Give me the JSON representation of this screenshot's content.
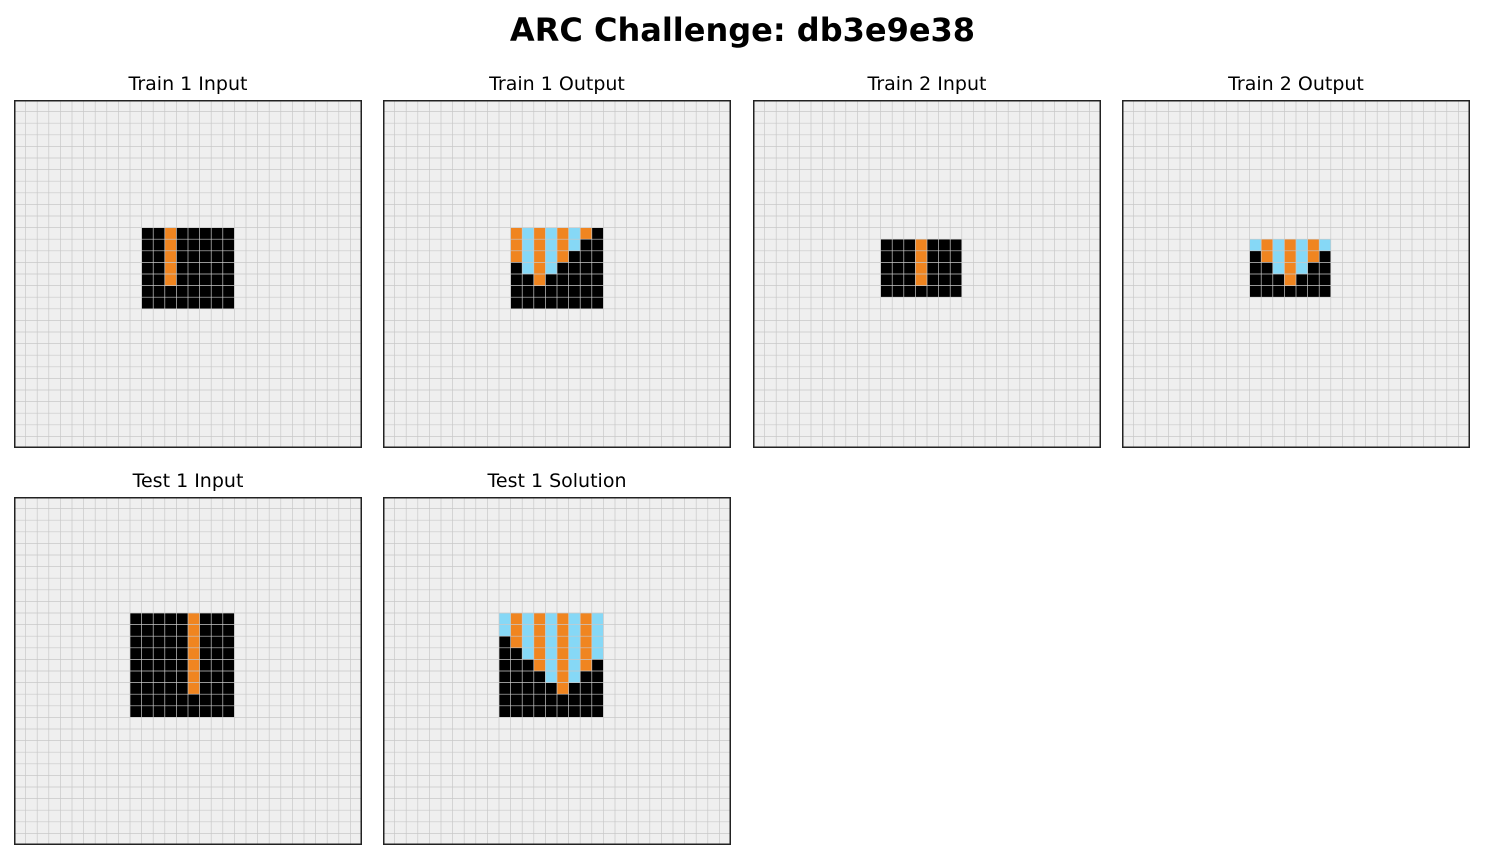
{
  "title": "ARC Challenge: db3e9e38",
  "colors": {
    "background": "#efefef",
    "gridline": "#c8c8c8",
    "border": "#222222",
    "0": "#000000",
    "7": "#f08520",
    "8": "#86d8f6"
  },
  "grid_size": 30,
  "panels": [
    {
      "label": "Train 1 Input",
      "cells": [
        {
          "r": 11,
          "c": 11,
          "w": 8,
          "h": 7,
          "v": 0
        },
        {
          "r": 11,
          "c": 13,
          "w": 1,
          "h": 5,
          "v": 7
        }
      ]
    },
    {
      "label": "Train 1 Output",
      "cells": [
        {
          "r": 11,
          "c": 11,
          "w": 8,
          "h": 7,
          "v": 0
        },
        {
          "r": 11,
          "c": 11,
          "w": 1,
          "h": 3,
          "v": 7
        },
        {
          "r": 11,
          "c": 12,
          "w": 1,
          "h": 4,
          "v": 8
        },
        {
          "r": 11,
          "c": 13,
          "w": 1,
          "h": 5,
          "v": 7
        },
        {
          "r": 11,
          "c": 14,
          "w": 1,
          "h": 4,
          "v": 8
        },
        {
          "r": 11,
          "c": 15,
          "w": 1,
          "h": 3,
          "v": 7
        },
        {
          "r": 11,
          "c": 16,
          "w": 1,
          "h": 2,
          "v": 8
        },
        {
          "r": 11,
          "c": 17,
          "w": 1,
          "h": 1,
          "v": 7
        }
      ]
    },
    {
      "label": "Train 2 Input",
      "cells": [
        {
          "r": 12,
          "c": 11,
          "w": 7,
          "h": 5,
          "v": 0
        },
        {
          "r": 12,
          "c": 14,
          "w": 1,
          "h": 4,
          "v": 7
        }
      ]
    },
    {
      "label": "Train 2 Output",
      "cells": [
        {
          "r": 12,
          "c": 11,
          "w": 7,
          "h": 5,
          "v": 0
        },
        {
          "r": 12,
          "c": 11,
          "w": 1,
          "h": 1,
          "v": 8
        },
        {
          "r": 12,
          "c": 12,
          "w": 1,
          "h": 2,
          "v": 7
        },
        {
          "r": 12,
          "c": 13,
          "w": 1,
          "h": 3,
          "v": 8
        },
        {
          "r": 12,
          "c": 14,
          "w": 1,
          "h": 4,
          "v": 7
        },
        {
          "r": 12,
          "c": 15,
          "w": 1,
          "h": 3,
          "v": 8
        },
        {
          "r": 12,
          "c": 16,
          "w": 1,
          "h": 2,
          "v": 7
        },
        {
          "r": 12,
          "c": 17,
          "w": 1,
          "h": 1,
          "v": 8
        }
      ]
    },
    {
      "label": "Test 1 Input",
      "cells": [
        {
          "r": 10,
          "c": 10,
          "w": 9,
          "h": 9,
          "v": 0
        },
        {
          "r": 10,
          "c": 15,
          "w": 1,
          "h": 7,
          "v": 7
        }
      ]
    },
    {
      "label": "Test 1 Solution",
      "cells": [
        {
          "r": 10,
          "c": 10,
          "w": 9,
          "h": 9,
          "v": 0
        },
        {
          "r": 10,
          "c": 10,
          "w": 1,
          "h": 2,
          "v": 8
        },
        {
          "r": 10,
          "c": 11,
          "w": 1,
          "h": 3,
          "v": 7
        },
        {
          "r": 10,
          "c": 12,
          "w": 1,
          "h": 4,
          "v": 8
        },
        {
          "r": 10,
          "c": 13,
          "w": 1,
          "h": 5,
          "v": 7
        },
        {
          "r": 10,
          "c": 14,
          "w": 1,
          "h": 6,
          "v": 8
        },
        {
          "r": 10,
          "c": 15,
          "w": 1,
          "h": 7,
          "v": 7
        },
        {
          "r": 10,
          "c": 16,
          "w": 1,
          "h": 6,
          "v": 8
        },
        {
          "r": 10,
          "c": 17,
          "w": 1,
          "h": 5,
          "v": 7
        },
        {
          "r": 10,
          "c": 18,
          "w": 1,
          "h": 4,
          "v": 8
        }
      ]
    }
  ]
}
